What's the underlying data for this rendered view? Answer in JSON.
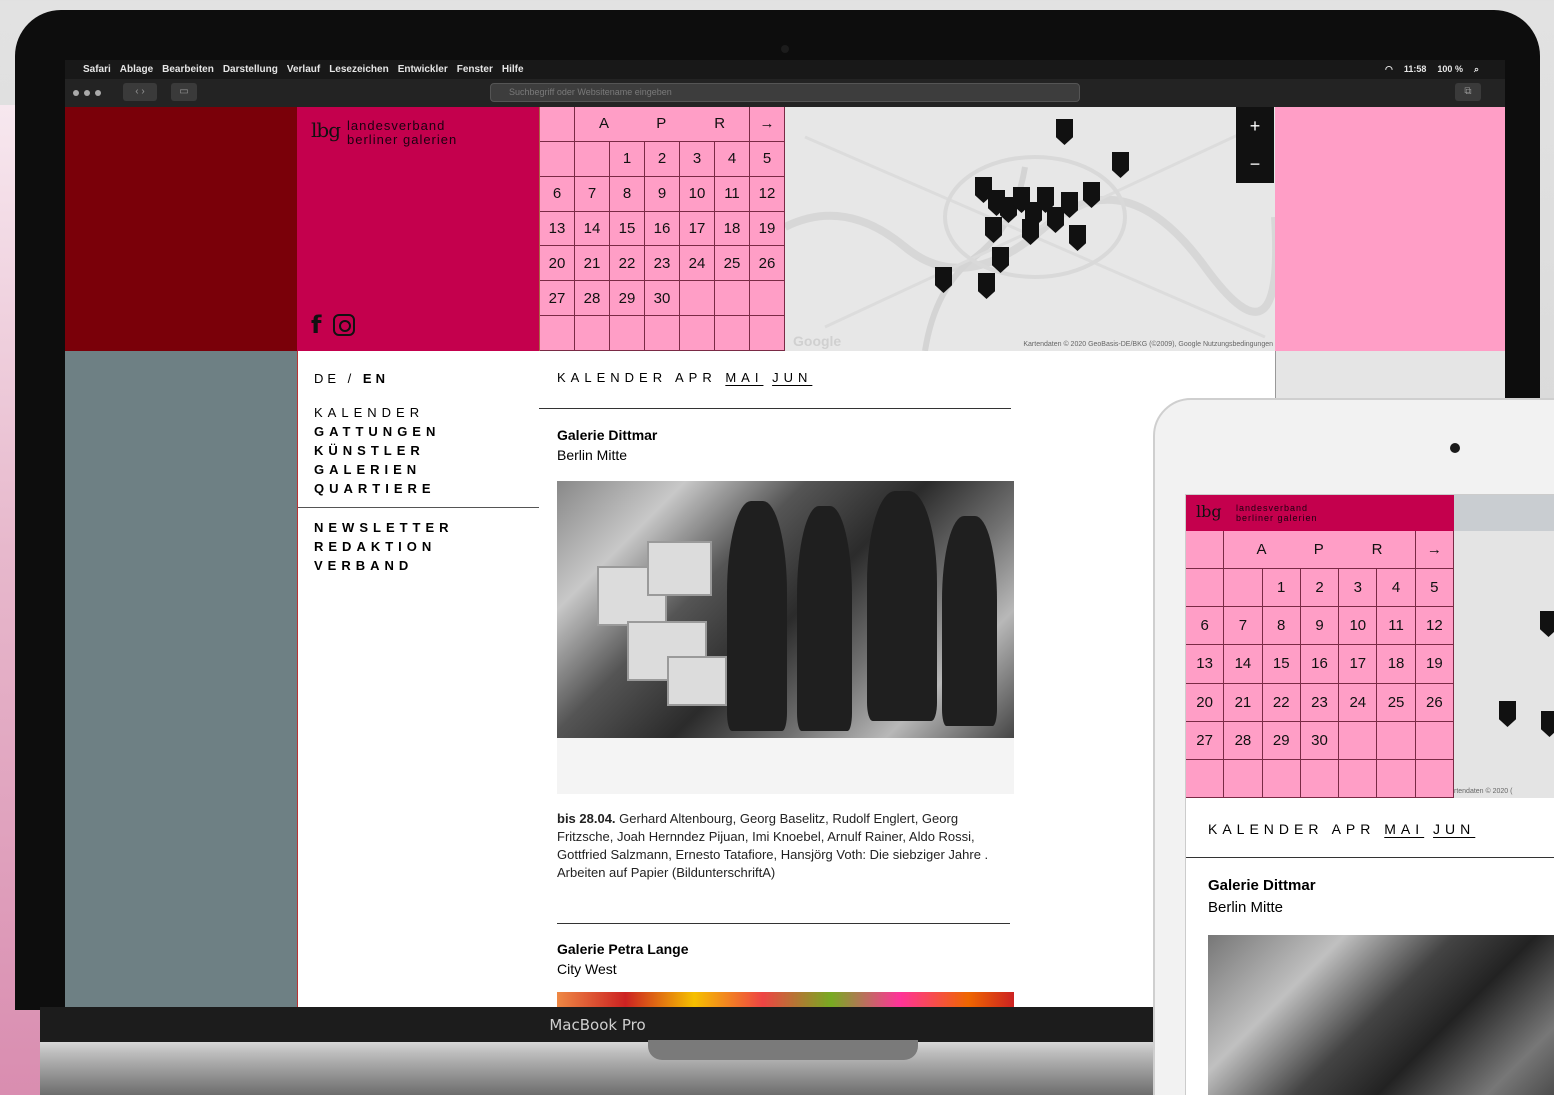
{
  "menubar": {
    "items": [
      "Safari",
      "Ablage",
      "Bearbeiten",
      "Darstellung",
      "Verlauf",
      "Lesezeichen",
      "Entwickler",
      "Fenster",
      "Hilfe"
    ],
    "status": [
      "11:58",
      "100 %"
    ]
  },
  "browser": {
    "url_placeholder": "Suchbegriff oder Websitename eingeben"
  },
  "logo": {
    "mark": "lbg",
    "line1": "landesverband",
    "line2": "berliner galerien"
  },
  "calendar": {
    "month": "A P R",
    "next": "→",
    "rows": [
      [
        "",
        "",
        "1",
        "2",
        "3",
        "4",
        "5"
      ],
      [
        "6",
        "7",
        "8",
        "9",
        "10",
        "11",
        "12"
      ],
      [
        "13",
        "14",
        "15",
        "16",
        "17",
        "18",
        "19"
      ],
      [
        "20",
        "21",
        "22",
        "23",
        "24",
        "25",
        "26"
      ],
      [
        "27",
        "28",
        "29",
        "30",
        "",
        "",
        ""
      ],
      [
        "",
        "",
        "",
        "",
        "",
        "",
        ""
      ]
    ]
  },
  "map": {
    "copyright": "Kartendaten © 2020 GeoBasis-DE/BKG (©2009), Google   Nutzungsbedingungen",
    "google": "Google",
    "zoom_in": "+",
    "zoom_out": "−"
  },
  "nav": {
    "lang_de": "DE",
    "lang_sep": " / ",
    "lang_en": "EN",
    "kalender": "KALENDER",
    "main": [
      "GATTUNGEN",
      "KÜNSTLER",
      "GALERIEN",
      "QUARTIERE"
    ],
    "secondary": [
      "NEWSLETTER",
      "REDAKTION",
      "VERBAND"
    ]
  },
  "content": {
    "kal_label": "KALENDER APR",
    "kal_mai": "MAI",
    "kal_jun": "JUN",
    "entries": [
      {
        "name": "Galerie Dittmar",
        "location": "Berlin Mitte",
        "date": "bis 28.04.",
        "caption": " Gerhard Altenbourg, Georg Baselitz, Rudolf Englert, Georg Fritzsche, Joah Hernndez Pijuan, Imi Knoebel, Arnulf Rainer, Aldo Rossi, Gottfried Salzmann, Ernesto Tatafiore, Hansjörg Voth: Die siebziger Jahre . Arbeiten auf Papier (BildunterschriftA)"
      },
      {
        "name": "Galerie Petra Lange",
        "location": "City West"
      }
    ]
  },
  "device": {
    "label": "MacBook Pro"
  },
  "tablet": {
    "map_copyright": "rtendaten © 2020 (",
    "kal_label": "KALENDER APR",
    "kal_mai": "MAI",
    "kal_jun": "JUN",
    "name": "Galerie Dittmar",
    "location": "Berlin Mitte"
  },
  "colors": {
    "crimson": "#c4004d",
    "dark_red": "#7a0009",
    "pink": "#ff9ec6",
    "slate": "#6e8084"
  }
}
